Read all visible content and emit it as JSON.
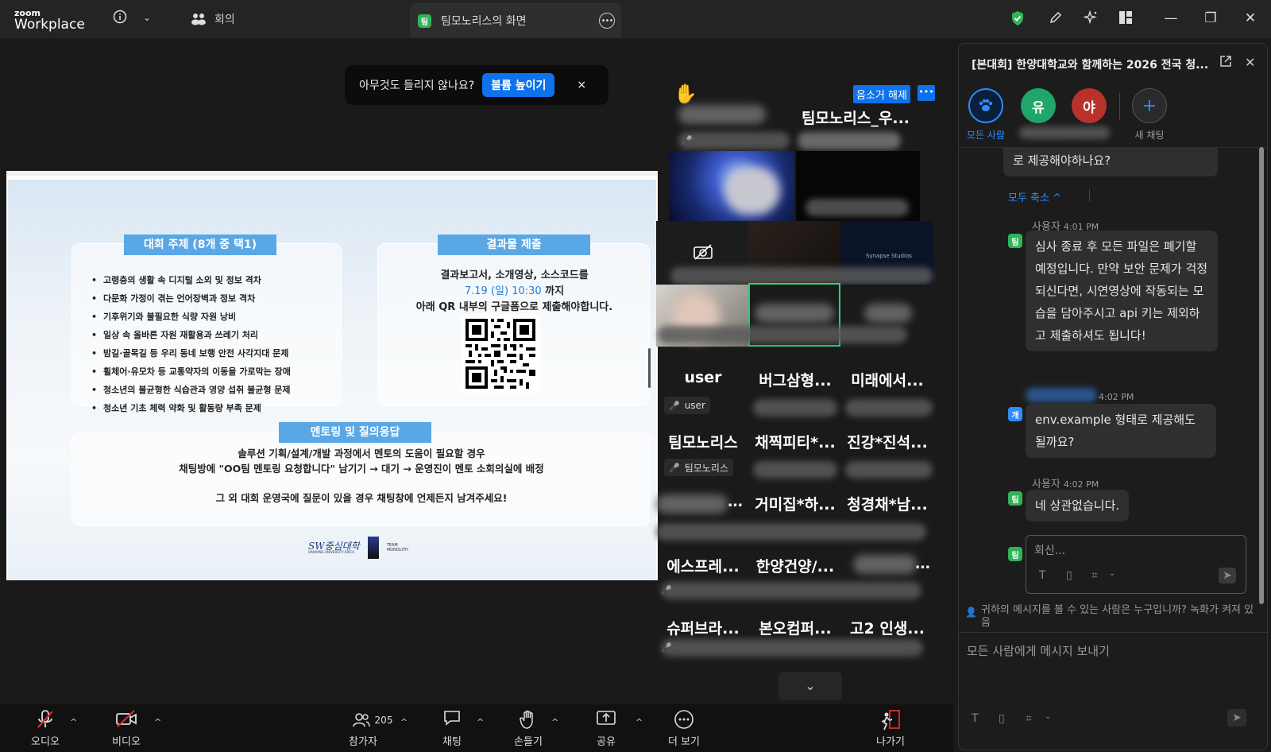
{
  "app": {
    "brand_top": "zoom",
    "brand_bottom": "Workplace"
  },
  "topbar": {
    "meeting_label": "회의",
    "share_tab_badge": "팀",
    "share_tab_title": "팀모노리스의 화면"
  },
  "notice": {
    "text": "아무것도 들리지 않나요?",
    "button": "볼륨 높이기",
    "close": "×"
  },
  "slide": {
    "topics_title": "대회 주제 (8개 중 택1)",
    "topics": [
      "고령층의 생활 속 디지털 소외 및 정보 격차",
      "다문화 가정이 겪는 언어장벽과 정보 격차",
      "기후위기와 불필요한 식량 자원 낭비",
      "일상 속 올바른 자원 재활용과 쓰레기 처리",
      "밤길·골목길 등 우리 동네 보행 안전 사각지대 문제",
      "휠체어·유모차 등 교통약자의 이동을 가로막는 장애",
      "청소년의 불균형한 식습관과 영양 섭취 불균형 문제",
      "청소년 기초 체력 약화 및 활동량 부족 문제"
    ],
    "submit_title": "결과물 제출",
    "submit_line1": "결과보고서, 소개영상, 소스코드를",
    "submit_deadline": "7.19 (일) 10:30",
    "submit_deadline_suffix": " 까지",
    "submit_line3": "아래 QR 내부의 구글폼으로 제출해야합니다.",
    "mentor_title": "멘토링 및 질의응답",
    "mentor_line1": "솔루션 기획/설계/개발 과정에서 멘토의 도움이 필요할 경우",
    "mentor_line2": "채팅방에 \"OO팀 멘토링 요청합니다\" 남기기 → 대기 → 운영진이 멘토 소회의실에 배정",
    "mentor_line3": "그 외 대회 운영국에 질문이 있을 경우 채팅창에 언제든지 남겨주세요!",
    "logo1": "SW중심대학",
    "logo1_sub": "HANYANG UNIVERSITY ERICA",
    "logo2": "TEAM MONOLITH"
  },
  "gallery": {
    "unmute_label": "음소거 해제",
    "raised_hand": "✋",
    "tiles": [
      {
        "name": "팀모노리스_우..."
      },
      {
        "name": "user",
        "sub": "user"
      },
      {
        "name": "버그삼형..."
      },
      {
        "name": "미래에서..."
      },
      {
        "name": "팀모노리스",
        "sub": "팀모노리스"
      },
      {
        "name": "채찍피티*..."
      },
      {
        "name": "진강*진석..."
      },
      {
        "name": "거미집*하..."
      },
      {
        "name": "청경채*남..."
      },
      {
        "name": "에스프레..."
      },
      {
        "name": "한양건양/..."
      },
      {
        "name": "슈퍼브라..."
      },
      {
        "name": "본오컴퍼..."
      },
      {
        "name": "고2 인생..."
      }
    ],
    "synapse_label": "Synapse Studios"
  },
  "toolbar": {
    "audio": "오디오",
    "video": "비디오",
    "participants": "참가자",
    "participants_count": "205",
    "chat": "채팅",
    "raise_hand": "손들기",
    "share": "공유",
    "more": "더 보기",
    "leave": "나가기"
  },
  "chat": {
    "title": "[본대회] 한양대학교와 함께하는 2026 전국 청...",
    "everyone_label": "모든 사람",
    "avatar_yu": "유",
    "avatar_ya": "야",
    "new_chat_label": "새 채팅",
    "prev_bubble": "로 제공해야하나요?",
    "collapse_all": "모두 축소 ^",
    "msg1_sender": "사용자",
    "msg1_time": "4:01 PM",
    "msg1_badge": "팀",
    "msg1_text": "심사 종료 후 모든 파일은 폐기할 예정입니다. 만약 보안 문제가 걱정되신다면, 시연영상에 작동되는 모습을 담아주시고 api 키는 제외하고 제출하셔도 됩니다!",
    "msg2_time": "4:02 PM",
    "msg2_badge": "개",
    "msg2_text": "env.example 형태로 제공해도 될까요?",
    "msg3_sender": "사용자",
    "msg3_time": "4:02 PM",
    "msg3_badge": "팀",
    "msg3_text": "네 상관없습니다.",
    "reply_badge": "팀",
    "reply_placeholder": "회신...",
    "privacy_text": "귀하의 메시지를 볼 수 있는 사람은 누구입니까? 녹화가 켜져 있음",
    "compose_placeholder": "모든 사람에게 메시지 보내기"
  },
  "colors": {
    "accent": "#0e72ed",
    "mute_red": "#e02828",
    "active_green": "#2fb457",
    "leave_red": "#e02828"
  }
}
